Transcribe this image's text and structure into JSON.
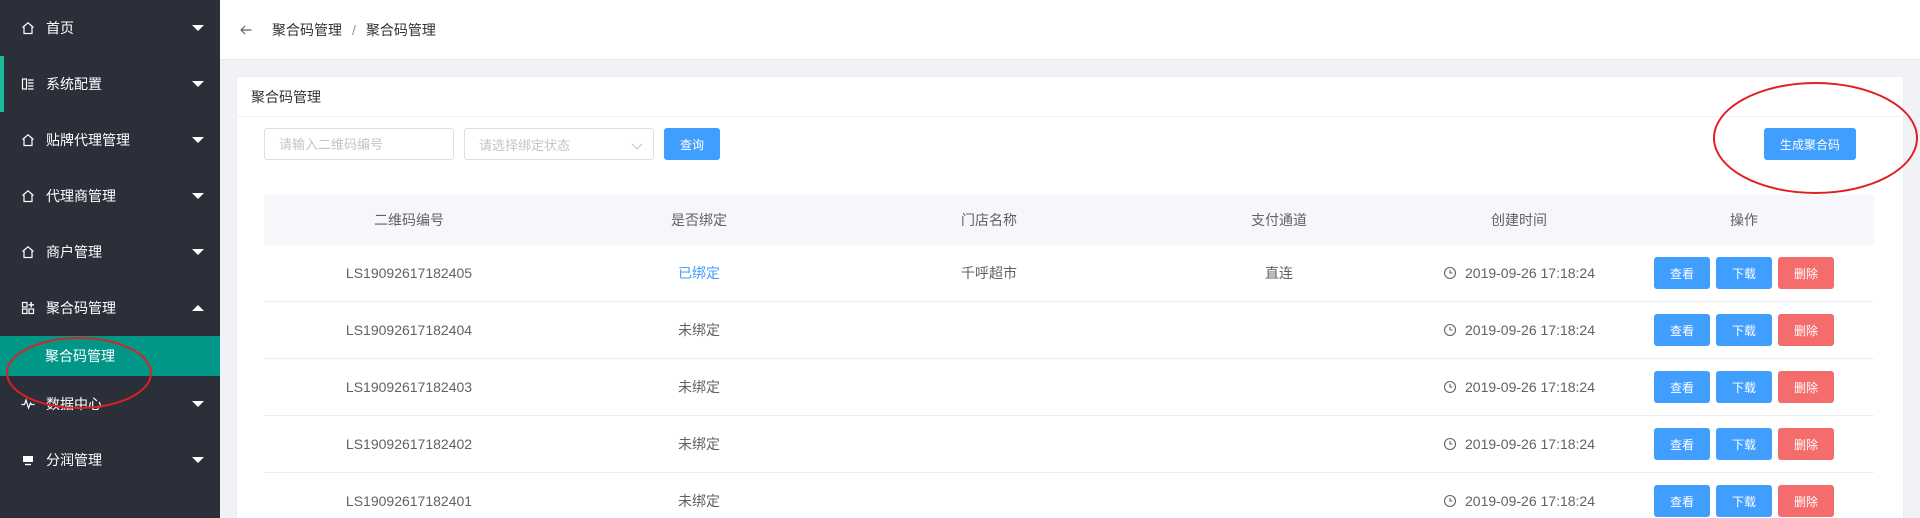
{
  "sidebar": {
    "items": [
      {
        "label": "首页",
        "icon": "home-icon"
      },
      {
        "label": "系统配置",
        "icon": "settings-icon"
      },
      {
        "label": "贴牌代理管理",
        "icon": "home-icon"
      },
      {
        "label": "代理商管理",
        "icon": "home-icon"
      },
      {
        "label": "商户管理",
        "icon": "home-icon"
      },
      {
        "label": "聚合码管理",
        "icon": "qrcode-grid-icon"
      },
      {
        "label": "数据中心",
        "icon": "pulse-icon"
      },
      {
        "label": "分润管理",
        "icon": "monitor-icon"
      }
    ],
    "submenu": {
      "label": "聚合码管理"
    }
  },
  "header": {
    "breadcrumb": [
      "聚合码管理",
      "聚合码管理"
    ],
    "separator": "/"
  },
  "card": {
    "title": "聚合码管理"
  },
  "filters": {
    "code_placeholder": "请输入二维码编号",
    "status_placeholder": "请选择绑定状态",
    "search_label": "查询",
    "generate_label": "生成聚合码"
  },
  "table": {
    "columns": [
      "二维码编号",
      "是否绑定",
      "门店名称",
      "支付通道",
      "创建时间",
      "操作"
    ],
    "rows": [
      {
        "code": "LS19092617182405",
        "bound": "已绑定",
        "store": "千呼超市",
        "channel": "直连",
        "created": "2019-09-26 17:18:24"
      },
      {
        "code": "LS19092617182404",
        "bound": "未绑定",
        "store": "",
        "channel": "",
        "created": "2019-09-26 17:18:24"
      },
      {
        "code": "LS19092617182403",
        "bound": "未绑定",
        "store": "",
        "channel": "",
        "created": "2019-09-26 17:18:24"
      },
      {
        "code": "LS19092617182402",
        "bound": "未绑定",
        "store": "",
        "channel": "",
        "created": "2019-09-26 17:18:24"
      },
      {
        "code": "LS19092617182401",
        "bound": "未绑定",
        "store": "",
        "channel": "",
        "created": "2019-09-26 17:18:24"
      }
    ],
    "actions": {
      "view": "查看",
      "download": "下载",
      "delete": "删除"
    }
  },
  "colors": {
    "sidebar_bg": "#2b2f3a",
    "active_teal": "#009688",
    "primary": "#409eff",
    "danger": "#f56c6c",
    "annotation_red": "#e02020"
  }
}
